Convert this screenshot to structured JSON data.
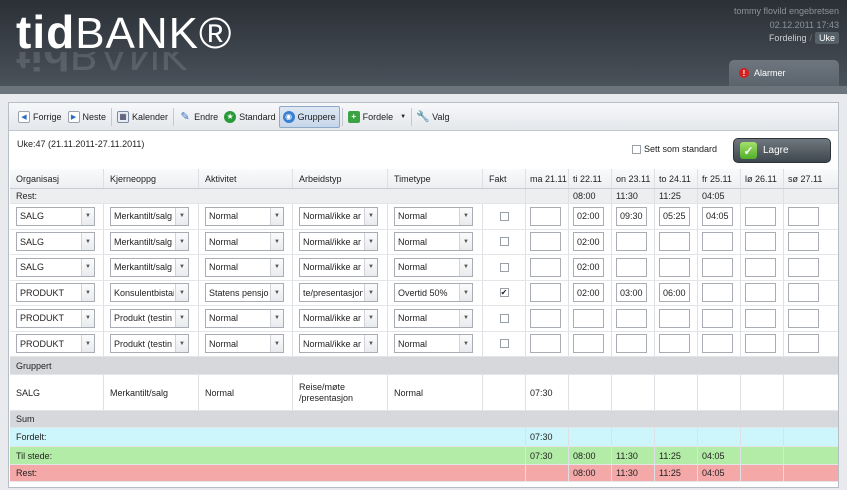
{
  "logo": {
    "text": "tidBANK®",
    "bold": "tid",
    "rest": "BANK®"
  },
  "user": {
    "name": "tommy flovild engebretsen",
    "datetime": "02.12.2011 17:43"
  },
  "nav": {
    "fordeling": "Fordeling",
    "uke": "Uke",
    "sep": "/"
  },
  "alarm": {
    "label": "Alarmer",
    "icon": "alert-icon"
  },
  "toolbar": {
    "forrige": "Forrige",
    "neste": "Neste",
    "kalender": "Kalender",
    "endre": "Endre",
    "standard": "Standard",
    "gruppere": "Gruppere",
    "fordele": "Fordele",
    "valg": "Valg"
  },
  "week": {
    "label": "Uke:47 (21.11.2011-27.11.2011)"
  },
  "sett_som_standard": "Sett som standard",
  "lagre": "Lagre",
  "columns": [
    "Organisasj",
    "Kjerneoppg",
    "Aktivitet",
    "Arbeidstyp",
    "Timetype",
    "Fakt",
    "ma 21.11",
    "ti 22.11",
    "on 23.11",
    "to 24.11",
    "fr 25.11",
    "lø 26.11",
    "sø 27.11"
  ],
  "rest_top": {
    "label": "Rest:",
    "days": [
      "",
      "08:00",
      "11:30",
      "11:25",
      "04:05",
      "",
      ""
    ]
  },
  "rows": [
    {
      "org": "SALG",
      "kj": "Merkantilt/salg",
      "akt": "Normal",
      "arb": "Normal/ikke ar",
      "tt": "Normal",
      "fakt": false,
      "days": [
        "",
        "02:00",
        "09:30",
        "05:25",
        "04:05",
        "",
        ""
      ]
    },
    {
      "org": "SALG",
      "kj": "Merkantilt/salg",
      "akt": "Normal",
      "arb": "Normal/ikke ar",
      "tt": "Normal",
      "fakt": false,
      "days": [
        "",
        "02:00",
        "",
        "",
        "",
        "",
        ""
      ]
    },
    {
      "org": "SALG",
      "kj": "Merkantilt/salg",
      "akt": "Normal",
      "arb": "Normal/ikke ar",
      "tt": "Normal",
      "fakt": false,
      "days": [
        "",
        "02:00",
        "",
        "",
        "",
        "",
        ""
      ]
    },
    {
      "org": "PRODUKT",
      "kj": "Konsulentbistai",
      "akt": "Statens pensjor",
      "arb": "te/presentasjon",
      "tt": "Overtid 50%",
      "fakt": true,
      "days": [
        "",
        "02:00",
        "03:00",
        "06:00",
        "",
        "",
        ""
      ]
    },
    {
      "org": "PRODUKT",
      "kj": "Produkt (testin",
      "akt": "Normal",
      "arb": "Normal/ikke ar",
      "tt": "Normal",
      "fakt": false,
      "days": [
        "",
        "",
        "",
        "",
        "",
        "",
        ""
      ]
    },
    {
      "org": "PRODUKT",
      "kj": "Produkt (testin",
      "akt": "Normal",
      "arb": "Normal/ikke ar",
      "tt": "Normal",
      "fakt": false,
      "days": [
        "",
        "",
        "",
        "",
        "",
        "",
        ""
      ]
    }
  ],
  "gruppert": {
    "label": "Gruppert",
    "row": {
      "org": "SALG",
      "kj": "Merkantilt/salg",
      "akt": "Normal",
      "arb": "Reise/møte /presentasjon",
      "tt": "Normal",
      "days": [
        "07:30",
        "",
        "",
        "",
        "",
        "",
        ""
      ]
    }
  },
  "sum": {
    "label": "Sum"
  },
  "fordelt": {
    "label": "Fordelt:",
    "days": [
      "07:30",
      "",
      "",
      "",
      "",
      "",
      ""
    ]
  },
  "til_stede": {
    "label": "Til stede:",
    "days": [
      "07:30",
      "08:00",
      "11:30",
      "11:25",
      "04:05",
      "",
      ""
    ]
  },
  "rest_bottom": {
    "label": "Rest:",
    "days": [
      "",
      "08:00",
      "11:30",
      "11:25",
      "04:05",
      "",
      ""
    ]
  },
  "colors": {
    "fordelt": "#ccf6fb",
    "til_stede": "#b3eca6",
    "rest": "#f4a8a8",
    "accent": "#3a7fd0"
  }
}
